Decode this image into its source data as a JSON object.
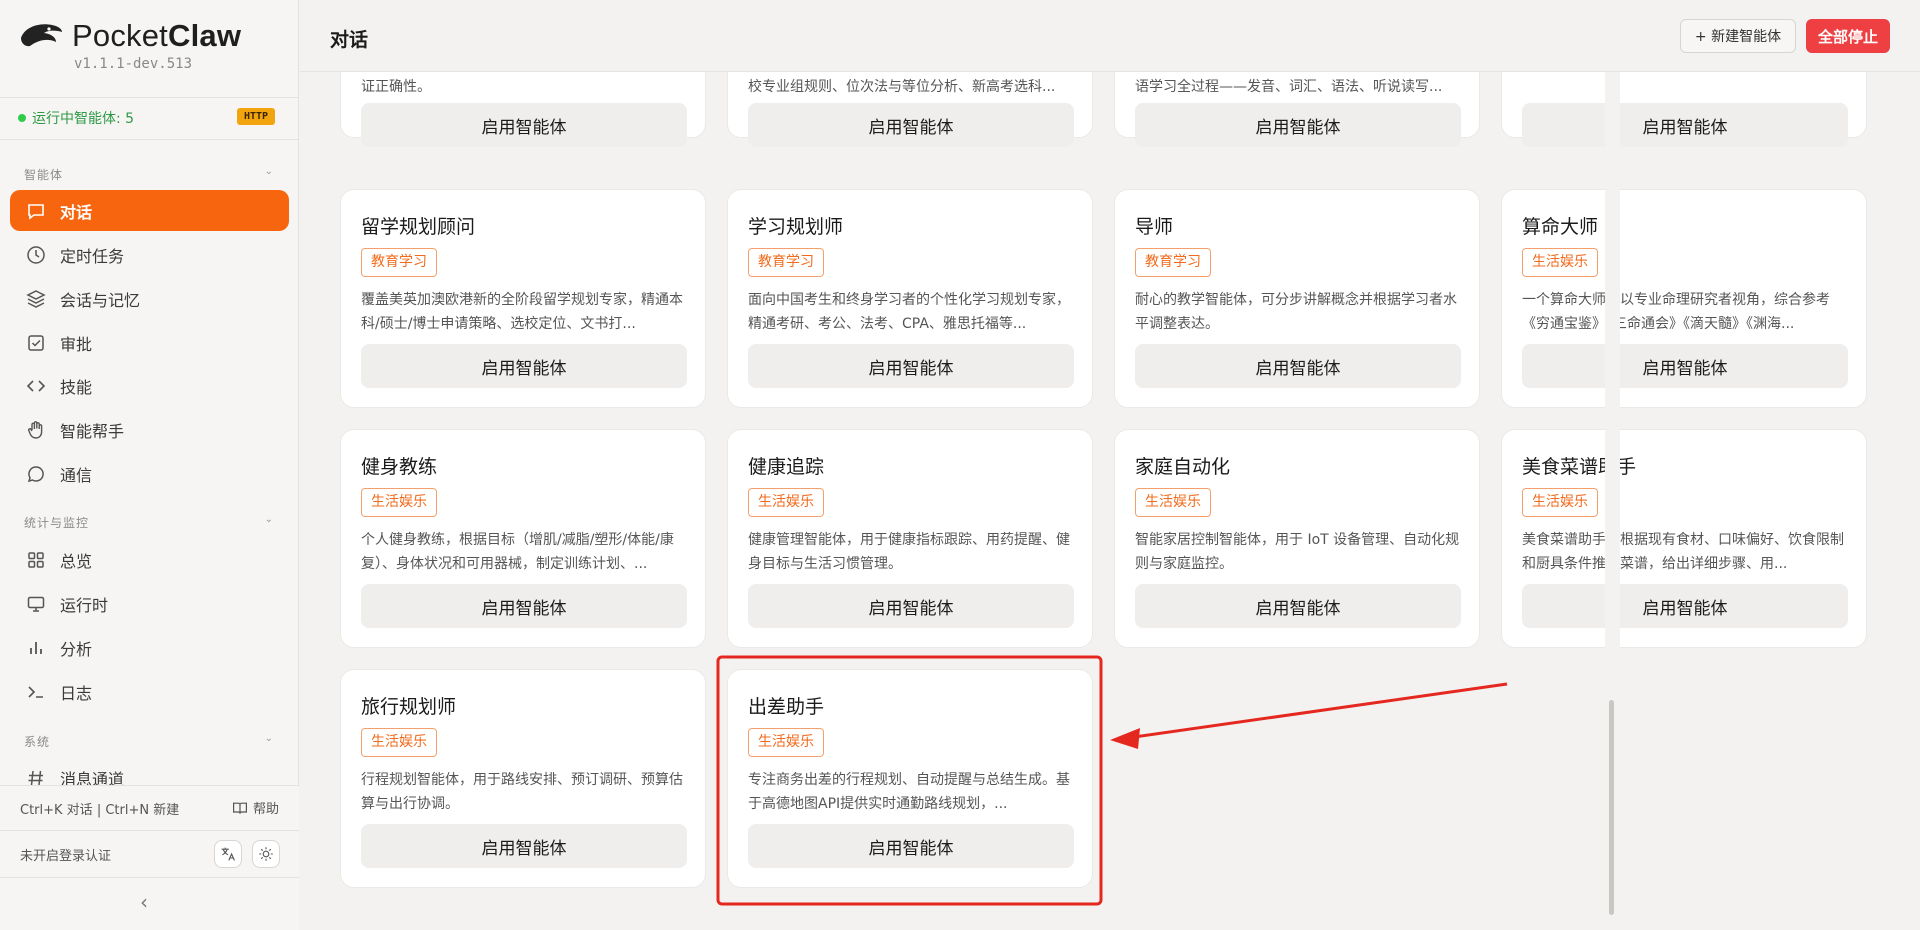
{
  "sidebar": {
    "brand_prefix": "Pocket",
    "brand_suffix": "Claw",
    "version": "v1.1.1-dev.513",
    "running_text": "运行中智能体: 5",
    "protocol_badge": "HTTP",
    "sections": {
      "agents": "智能体",
      "stats": "统计与监控",
      "system": "系统"
    },
    "items": [
      {
        "label": "对话",
        "icon": "chat-icon"
      },
      {
        "label": "定时任务",
        "icon": "clock-icon"
      },
      {
        "label": "会话与记忆",
        "icon": "layers-icon"
      },
      {
        "label": "审批",
        "icon": "check-square-icon"
      },
      {
        "label": "技能",
        "icon": "code-icon"
      },
      {
        "label": "智能帮手",
        "icon": "hand-icon"
      },
      {
        "label": "通信",
        "icon": "message-circle-icon"
      },
      {
        "label": "总览",
        "icon": "grid-icon"
      },
      {
        "label": "运行时",
        "icon": "monitor-icon"
      },
      {
        "label": "分析",
        "icon": "bar-chart-icon"
      },
      {
        "label": "日志",
        "icon": "terminal-icon"
      },
      {
        "label": "消息通道",
        "icon": "hash-icon"
      }
    ],
    "shortcut": "Ctrl+K 对话 | Ctrl+N 新建",
    "help": "帮助",
    "auth_status": "未开启登录认证",
    "collapse_glyph": "‹"
  },
  "header": {
    "title": "对话",
    "new_agent": "+ 新建智能体",
    "stop_all": "全部停止"
  },
  "enable_label": "启用智能体",
  "top_row": [
    {
      "desc": "证正确性。"
    },
    {
      "desc": "校专业组规则、位次法与等位分析、新高考选科..."
    },
    {
      "desc": "语学习全过程——发音、词汇、语法、听说读写..."
    },
    {
      "desc": ""
    }
  ],
  "cards": [
    {
      "title": "留学规划顾问",
      "tag": "教育学习",
      "desc": "覆盖美英加澳欧港新的全阶段留学规划专家，精通本科/硕士/博士申请策略、选校定位、文书打..."
    },
    {
      "title": "学习规划师",
      "tag": "教育学习",
      "desc": "面向中国考生和终身学习者的个性化学习规划专家，精通考研、考公、法考、CPA、雅思托福等..."
    },
    {
      "title": "导师",
      "tag": "教育学习",
      "desc": "耐心的教学智能体，可分步讲解概念并根据学习者水平调整表达。"
    },
    {
      "title": "算命大师",
      "tag": "生活娱乐",
      "desc": "一个算命大师，以专业命理研究者视角，综合参考《穷通宝鉴》《三命通会》《滴天髓》《渊海..."
    },
    {
      "title": "健身教练",
      "tag": "生活娱乐",
      "desc": "个人健身教练，根据目标（增肌/减脂/塑形/体能/康复）、身体状况和可用器械，制定训练计划、..."
    },
    {
      "title": "健康追踪",
      "tag": "生活娱乐",
      "desc": "健康管理智能体，用于健康指标跟踪、用药提醒、健身目标与生活习惯管理。"
    },
    {
      "title": "家庭自动化",
      "tag": "生活娱乐",
      "desc": "智能家居控制智能体，用于 IoT 设备管理、自动化规则与家庭监控。"
    },
    {
      "title": "美食菜谱助手",
      "tag": "生活娱乐",
      "desc": "美食菜谱助手，根据现有食材、口味偏好、饮食限制和厨具条件推荐菜谱，给出详细步骤、用..."
    },
    {
      "title": "旅行规划师",
      "tag": "生活娱乐",
      "desc": "行程规划智能体，用于路线安排、预订调研、预算估算与出行协调。"
    },
    {
      "title": "出差助手",
      "tag": "生活娱乐",
      "desc": "专注商务出差的行程规划、自动提醒与总结生成。基于高德地图API提供实时通勤路线规划，..."
    }
  ],
  "colors": {
    "accent": "#f7660e",
    "danger": "#ee3f42",
    "annotation": "#e5281f",
    "running": "#2ecc4a"
  }
}
